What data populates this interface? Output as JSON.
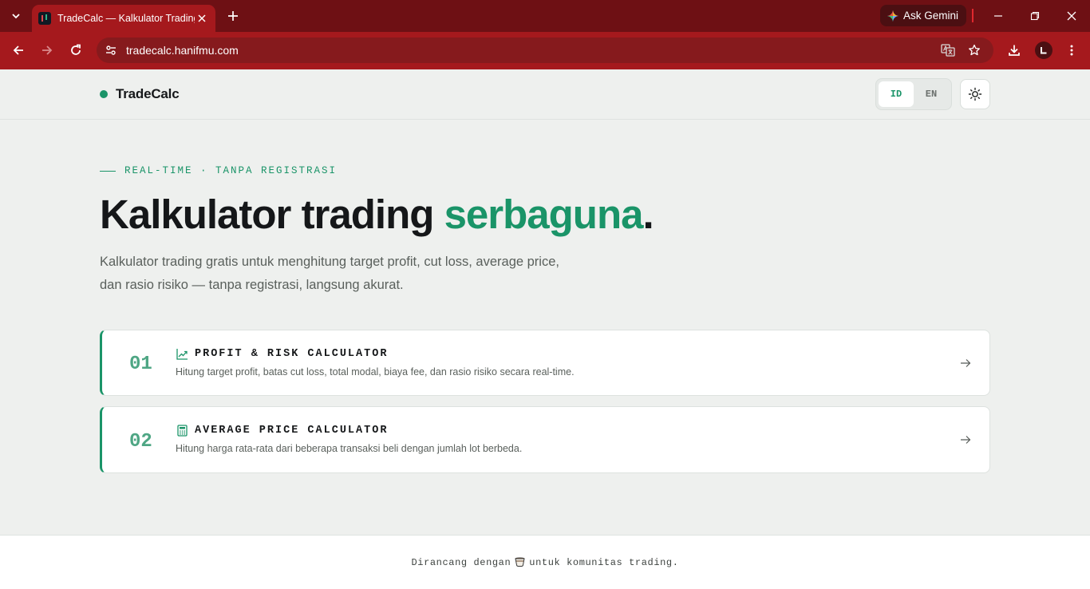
{
  "browser": {
    "tab": {
      "title": "TradeCalc — Kalkulator Trading"
    },
    "gemini_label": "Ask Gemini",
    "url": "tradecalc.hanifmu.com",
    "profile_initial": "L"
  },
  "header": {
    "brand": "TradeCalc",
    "lang_options": [
      "ID",
      "EN"
    ],
    "lang_active": "ID"
  },
  "hero": {
    "eyebrow": "REAL-TIME · TANPA REGISTRASI",
    "headline_main": "Kalkulator trading ",
    "headline_accent": "serbaguna",
    "headline_end": ".",
    "lead": "Kalkulator trading gratis untuk menghitung target profit, cut loss, average price, dan rasio risiko — tanpa registrasi, langsung akurat."
  },
  "cards": [
    {
      "number": "01",
      "icon": "trending-up-icon",
      "title": "PROFIT & RISK CALCULATOR",
      "description": "Hitung target profit, batas cut loss, total modal, biaya fee, dan rasio risiko secara real-time."
    },
    {
      "number": "02",
      "icon": "calculator-icon",
      "title": "AVERAGE PRICE CALCULATOR",
      "description": "Hitung harga rata-rata dari beberapa transaksi beli dengan jumlah lot berbeda."
    }
  ],
  "footer": {
    "text_before": "Dirancang dengan",
    "emoji_icon": "cup-icon",
    "text_after": "untuk komunitas trading."
  },
  "colors": {
    "accent": "#1a9468",
    "browser_frame": "#6e1014",
    "browser_toolbar": "#a5191d"
  }
}
